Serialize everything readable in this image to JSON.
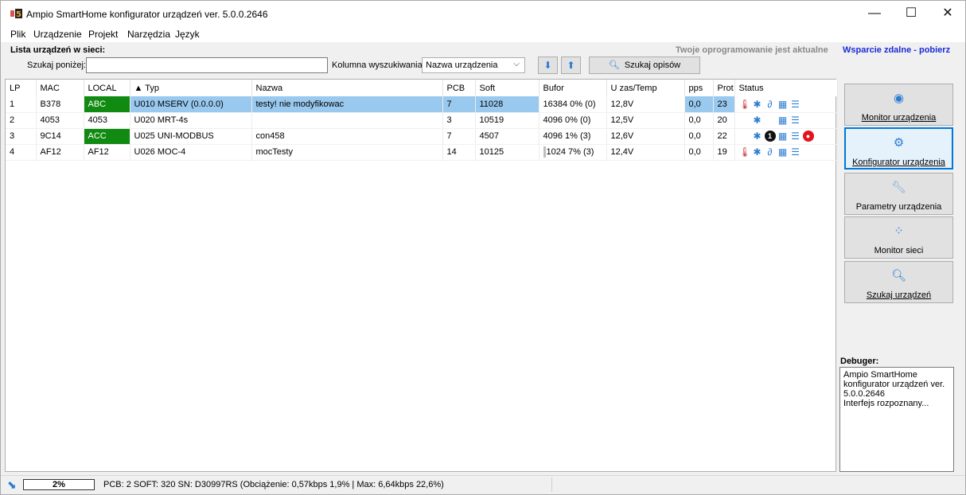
{
  "window": {
    "title": "Ampio SmartHome konfigurator urządzeń ver. 5.0.0.2646",
    "minimize": "—",
    "maximize": "☐",
    "close": "✕"
  },
  "menu": [
    {
      "label": "Plik"
    },
    {
      "label": "Urządzenie"
    },
    {
      "label": "Projekt"
    },
    {
      "label": "Narzędzia"
    },
    {
      "label": "Język"
    }
  ],
  "search_panel": {
    "title": "Lista urządzeń w sieci:",
    "status_msg": "Twoje oprogramowanie jest aktualne",
    "support_link": "Wsparcie zdalne - pobierz",
    "search_label": "Szukaj poniżej:",
    "search_value": "",
    "column_label": "Kolumna wyszukiwania:",
    "column_selected": "Nazwa urządzenia",
    "search_desc_button": "Szukaj opisów"
  },
  "table": {
    "columns": [
      "LP",
      "MAC",
      "LOCAL",
      "▲ Typ",
      "Nazwa",
      "PCB",
      "Soft",
      "Bufor",
      "U zas/Temp",
      "pps",
      "Prot",
      "Status"
    ],
    "rows": [
      {
        "lp": "1",
        "mac": "B378",
        "local": "ABC",
        "local_green": true,
        "typ": "U010 MSERV (0.0.0.0)",
        "nazwa": "testy! nie modyfikowac",
        "pcb": "7",
        "soft": "11028",
        "bufor": "16384 0% (0)",
        "uzas": "12,8V",
        "pps": "0,0",
        "prot": "23",
        "selected": true
      },
      {
        "lp": "2",
        "mac": "4053",
        "local": "4053",
        "local_green": false,
        "typ": "U020 MRT-4s",
        "nazwa": "",
        "pcb": "3",
        "soft": "10519",
        "bufor": "4096 0% (0)",
        "uzas": "12,5V",
        "pps": "0,0",
        "prot": "20",
        "selected": false
      },
      {
        "lp": "3",
        "mac": "9C14",
        "local": "ACC",
        "local_green": true,
        "typ": "U025 UNI-MODBUS",
        "nazwa": "con458",
        "pcb": "7",
        "soft": "4507",
        "bufor": "4096 1% (3)",
        "uzas": "12,6V",
        "pps": "0,0",
        "prot": "22",
        "selected": false
      },
      {
        "lp": "4",
        "mac": "AF12",
        "local": "AF12",
        "local_green": false,
        "typ": "U026 MOC-4",
        "nazwa": "mocTesty",
        "pcb": "14",
        "soft": "10125",
        "bufor": "1024 7% (3)",
        "uzas": "12,4V",
        "pps": "0,0",
        "prot": "19",
        "selected": false
      }
    ]
  },
  "side_buttons": [
    {
      "label": "Monitor urządzenia",
      "icon": "eye-icon"
    },
    {
      "label": "Konfigurator urządzenia",
      "icon": "gears-icon"
    },
    {
      "label": "Parametry urządzenia",
      "icon": "wrench-icon"
    },
    {
      "label": "Monitor sieci",
      "icon": "spinner-icon"
    },
    {
      "label": "Szukaj urządzeń",
      "icon": "search-icon"
    }
  ],
  "debugger": {
    "label": "Debuger:",
    "text": "Ampio SmartHome konfigurator urządzeń ver. 5.0.0.2646\nInterfejs rozpoznany..."
  },
  "statusbar": {
    "progress": "2%",
    "info": "PCB: 2 SOFT: 320 SN: D30997RS (Obciążenie: 0,57kbps 1,9% | Max: 6,64kbps 22,6%)"
  }
}
